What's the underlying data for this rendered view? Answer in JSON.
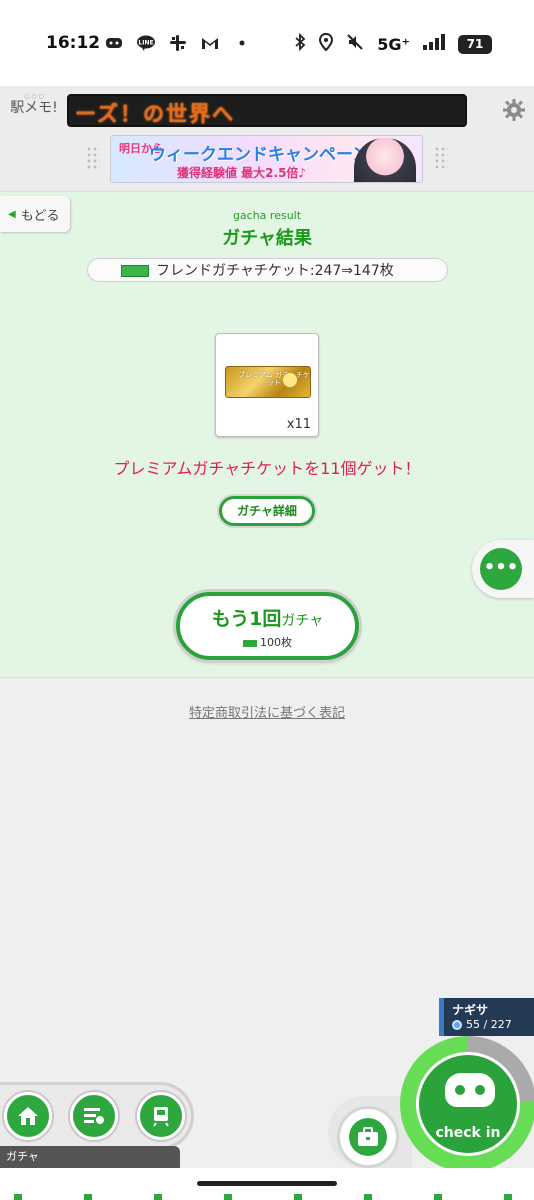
{
  "status_bar": {
    "time": "16:12",
    "network": "5G⁺",
    "battery": "71",
    "left_icons": [
      "discord-icon",
      "line-icon",
      "slack-icon",
      "gmail-icon",
      "dot-icon"
    ],
    "right_icons": [
      "bluetooth-icon",
      "location-icon",
      "mute-icon",
      "signal-icon"
    ]
  },
  "header": {
    "logo_text": "駅メモ!",
    "ticker_text": "ーズ！の世界へ",
    "banner": {
      "left_text": "明日から",
      "title": "ウィークエンドキャンペーン!",
      "subtitle": "獲得経験値 最大2.5倍♪"
    }
  },
  "main": {
    "back_label": "もどる",
    "subtitle_en": "gacha result",
    "title": "ガチャ結果",
    "ticket_usage": "フレンドガチャチケット:247⇒147枚",
    "prize": {
      "ticket_text": "プレミアム ガチャチケット",
      "count": "x11"
    },
    "result_message": "プレミアムガチャチケットを11個ゲット！",
    "detail_button": "ガチャ詳細",
    "again_button": {
      "big": "もう1回",
      "small": "ガチャ",
      "cost": "100枚"
    }
  },
  "legal_link": "特定商取引法に基づく表記",
  "player": {
    "name": "ナギサ",
    "xp": "55 / 227"
  },
  "bottom_nav": {
    "label": "ガチャ",
    "checkin": "check in"
  },
  "colors": {
    "accent_green": "#2ea83e",
    "panel_bg": "#e3f6e3",
    "result_red": "#e02050",
    "ticker_orange": "#e26a1c"
  }
}
